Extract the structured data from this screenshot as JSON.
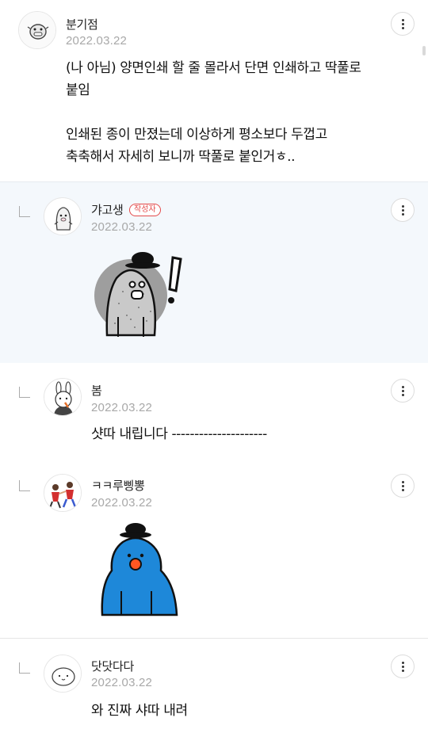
{
  "comments": [
    {
      "nickname": "분기점",
      "date": "2022.03.22",
      "text": "(나 아님) 양면인쇄 할 줄 몰라서 단면 인쇄하고 딱풀로\n붙임\n\n인쇄된 종이 만졌는데 이상하게 평소보다 두껍고\n축축해서 자세히 보니까 딱풀로 붙인거ㅎ..",
      "avatar_icon": "smiling-face-icon"
    },
    {
      "nickname": "갸고생",
      "badge": "작성자",
      "date": "2022.03.22",
      "sticker": "gray-hat-sticker-exclamation",
      "avatar_icon": "penguin-icon"
    },
    {
      "nickname": "봄",
      "date": "2022.03.22",
      "text": "샷따 내립니다 ---------------------",
      "avatar_icon": "rabbit-icon"
    },
    {
      "nickname": "ㅋㅋ루삥뽕",
      "date": "2022.03.22",
      "sticker": "blue-hat-sticker",
      "avatar_icon": "dancing-people-icon"
    },
    {
      "nickname": "닷닷다다",
      "date": "2022.03.22",
      "text": "와 진짜 샤따 내려",
      "avatar_icon": "round-face-icon"
    }
  ],
  "colors": {
    "author_badge": "#e34b4b",
    "reply_highlight_bg": "#f4f8fc",
    "blue_sticker": "#1e88d9",
    "gray_sticker": "#9e9e9e"
  }
}
